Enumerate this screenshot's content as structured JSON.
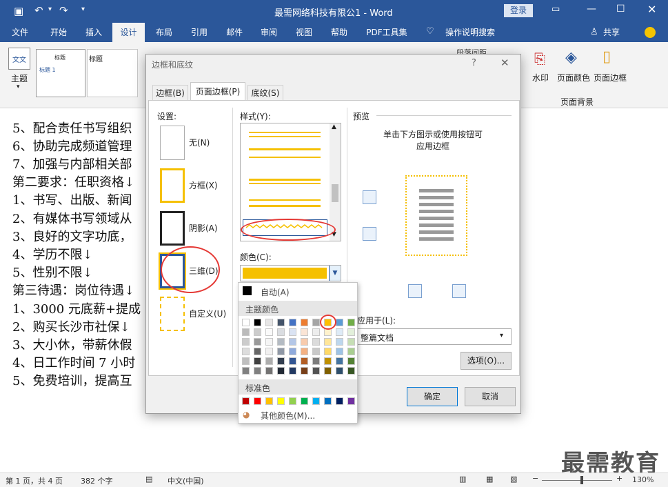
{
  "window": {
    "title": "最需网络科技有限公1 - Word",
    "login": "登录"
  },
  "tabs": [
    "文件",
    "开始",
    "插入",
    "设计",
    "布局",
    "引用",
    "邮件",
    "审阅",
    "视图",
    "帮助",
    "PDF工具集"
  ],
  "tell_me": "操作说明搜索",
  "share": "共享",
  "ribbon": {
    "theme": "主题",
    "gallery_title": "标题",
    "gallery_heading": "标题 1",
    "watermark": "水印",
    "page_color": "页面颜色",
    "page_border": "页面边框",
    "group_label": "页面背景",
    "partial": "段落间距"
  },
  "document": {
    "lines": [
      "5、配合责任书写组织",
      "6、协助完成频道管理",
      "7、加强与内部相关部",
      "第二要求：任职资格↓",
      "1、书写、出版、新闻",
      "2、有媒体书写领域从",
      "3、良好的文字功底，",
      "4、学历不限↓",
      "5、性别不限↓",
      "第三待遇：岗位待遇↓",
      "1、3000 元底薪+提成",
      "2、购买长沙市社保↓",
      "3、大小休，带薪休假",
      "4、日工作时间 7 小时",
      "5、免费培训，提高互"
    ],
    "watermark": "最需教育"
  },
  "dialog": {
    "title": "边框和底纹",
    "help": "?",
    "tabs": [
      "边框(B)",
      "页面边框(P)",
      "底纹(S)"
    ],
    "settings_label": "设置:",
    "settings": [
      "无(N)",
      "方框(X)",
      "阴影(A)",
      "三维(D)",
      "自定义(U)"
    ],
    "style_label": "样式(Y):",
    "color_label": "颜色(C):",
    "preview_label": "预览",
    "preview_hint": [
      "单击下方图示或使用按钮可",
      "应用边框"
    ],
    "apply_label": "应用于(L):",
    "apply_value": "整篇文档",
    "options": "选项(O)...",
    "ok": "确定",
    "cancel": "取消",
    "selected_color": "#f5c000"
  },
  "palette": {
    "auto": "自动(A)",
    "theme_label": "主题颜色",
    "standard_label": "标准色",
    "more": "其他颜色(M)...",
    "theme_top": [
      "#ffffff",
      "#000000",
      "#e7e6e6",
      "#44546a",
      "#4472c4",
      "#ed7d31",
      "#a5a5a5",
      "#ffc000",
      "#5b9bd5",
      "#70ad47"
    ],
    "standard": [
      "#c00000",
      "#ff0000",
      "#ffc000",
      "#ffff00",
      "#92d050",
      "#00b050",
      "#00b0f0",
      "#0070c0",
      "#002060",
      "#7030a0"
    ]
  },
  "status": {
    "page": "第 1 页，共 4 页",
    "words": "382 个字",
    "lang": "中文(中国)",
    "zoom": "130%"
  }
}
